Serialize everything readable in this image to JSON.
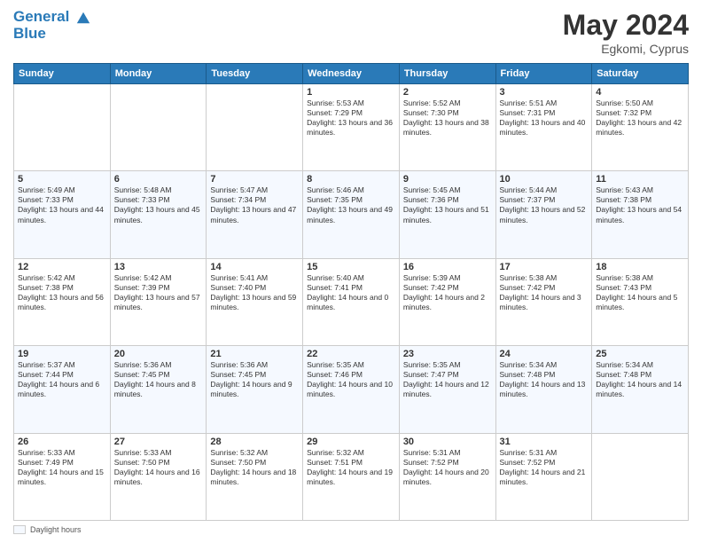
{
  "header": {
    "logo_line1": "General",
    "logo_line2": "Blue",
    "month": "May 2024",
    "location": "Egkomi, Cyprus"
  },
  "weekdays": [
    "Sunday",
    "Monday",
    "Tuesday",
    "Wednesday",
    "Thursday",
    "Friday",
    "Saturday"
  ],
  "footer": {
    "daylight_label": "Daylight hours"
  },
  "weeks": [
    [
      {
        "day": "",
        "sunrise": "",
        "sunset": "",
        "daylight": ""
      },
      {
        "day": "",
        "sunrise": "",
        "sunset": "",
        "daylight": ""
      },
      {
        "day": "",
        "sunrise": "",
        "sunset": "",
        "daylight": ""
      },
      {
        "day": "1",
        "sunrise": "Sunrise: 5:53 AM",
        "sunset": "Sunset: 7:29 PM",
        "daylight": "Daylight: 13 hours and 36 minutes."
      },
      {
        "day": "2",
        "sunrise": "Sunrise: 5:52 AM",
        "sunset": "Sunset: 7:30 PM",
        "daylight": "Daylight: 13 hours and 38 minutes."
      },
      {
        "day": "3",
        "sunrise": "Sunrise: 5:51 AM",
        "sunset": "Sunset: 7:31 PM",
        "daylight": "Daylight: 13 hours and 40 minutes."
      },
      {
        "day": "4",
        "sunrise": "Sunrise: 5:50 AM",
        "sunset": "Sunset: 7:32 PM",
        "daylight": "Daylight: 13 hours and 42 minutes."
      }
    ],
    [
      {
        "day": "5",
        "sunrise": "Sunrise: 5:49 AM",
        "sunset": "Sunset: 7:33 PM",
        "daylight": "Daylight: 13 hours and 44 minutes."
      },
      {
        "day": "6",
        "sunrise": "Sunrise: 5:48 AM",
        "sunset": "Sunset: 7:33 PM",
        "daylight": "Daylight: 13 hours and 45 minutes."
      },
      {
        "day": "7",
        "sunrise": "Sunrise: 5:47 AM",
        "sunset": "Sunset: 7:34 PM",
        "daylight": "Daylight: 13 hours and 47 minutes."
      },
      {
        "day": "8",
        "sunrise": "Sunrise: 5:46 AM",
        "sunset": "Sunset: 7:35 PM",
        "daylight": "Daylight: 13 hours and 49 minutes."
      },
      {
        "day": "9",
        "sunrise": "Sunrise: 5:45 AM",
        "sunset": "Sunset: 7:36 PM",
        "daylight": "Daylight: 13 hours and 51 minutes."
      },
      {
        "day": "10",
        "sunrise": "Sunrise: 5:44 AM",
        "sunset": "Sunset: 7:37 PM",
        "daylight": "Daylight: 13 hours and 52 minutes."
      },
      {
        "day": "11",
        "sunrise": "Sunrise: 5:43 AM",
        "sunset": "Sunset: 7:38 PM",
        "daylight": "Daylight: 13 hours and 54 minutes."
      }
    ],
    [
      {
        "day": "12",
        "sunrise": "Sunrise: 5:42 AM",
        "sunset": "Sunset: 7:38 PM",
        "daylight": "Daylight: 13 hours and 56 minutes."
      },
      {
        "day": "13",
        "sunrise": "Sunrise: 5:42 AM",
        "sunset": "Sunset: 7:39 PM",
        "daylight": "Daylight: 13 hours and 57 minutes."
      },
      {
        "day": "14",
        "sunrise": "Sunrise: 5:41 AM",
        "sunset": "Sunset: 7:40 PM",
        "daylight": "Daylight: 13 hours and 59 minutes."
      },
      {
        "day": "15",
        "sunrise": "Sunrise: 5:40 AM",
        "sunset": "Sunset: 7:41 PM",
        "daylight": "Daylight: 14 hours and 0 minutes."
      },
      {
        "day": "16",
        "sunrise": "Sunrise: 5:39 AM",
        "sunset": "Sunset: 7:42 PM",
        "daylight": "Daylight: 14 hours and 2 minutes."
      },
      {
        "day": "17",
        "sunrise": "Sunrise: 5:38 AM",
        "sunset": "Sunset: 7:42 PM",
        "daylight": "Daylight: 14 hours and 3 minutes."
      },
      {
        "day": "18",
        "sunrise": "Sunrise: 5:38 AM",
        "sunset": "Sunset: 7:43 PM",
        "daylight": "Daylight: 14 hours and 5 minutes."
      }
    ],
    [
      {
        "day": "19",
        "sunrise": "Sunrise: 5:37 AM",
        "sunset": "Sunset: 7:44 PM",
        "daylight": "Daylight: 14 hours and 6 minutes."
      },
      {
        "day": "20",
        "sunrise": "Sunrise: 5:36 AM",
        "sunset": "Sunset: 7:45 PM",
        "daylight": "Daylight: 14 hours and 8 minutes."
      },
      {
        "day": "21",
        "sunrise": "Sunrise: 5:36 AM",
        "sunset": "Sunset: 7:45 PM",
        "daylight": "Daylight: 14 hours and 9 minutes."
      },
      {
        "day": "22",
        "sunrise": "Sunrise: 5:35 AM",
        "sunset": "Sunset: 7:46 PM",
        "daylight": "Daylight: 14 hours and 10 minutes."
      },
      {
        "day": "23",
        "sunrise": "Sunrise: 5:35 AM",
        "sunset": "Sunset: 7:47 PM",
        "daylight": "Daylight: 14 hours and 12 minutes."
      },
      {
        "day": "24",
        "sunrise": "Sunrise: 5:34 AM",
        "sunset": "Sunset: 7:48 PM",
        "daylight": "Daylight: 14 hours and 13 minutes."
      },
      {
        "day": "25",
        "sunrise": "Sunrise: 5:34 AM",
        "sunset": "Sunset: 7:48 PM",
        "daylight": "Daylight: 14 hours and 14 minutes."
      }
    ],
    [
      {
        "day": "26",
        "sunrise": "Sunrise: 5:33 AM",
        "sunset": "Sunset: 7:49 PM",
        "daylight": "Daylight: 14 hours and 15 minutes."
      },
      {
        "day": "27",
        "sunrise": "Sunrise: 5:33 AM",
        "sunset": "Sunset: 7:50 PM",
        "daylight": "Daylight: 14 hours and 16 minutes."
      },
      {
        "day": "28",
        "sunrise": "Sunrise: 5:32 AM",
        "sunset": "Sunset: 7:50 PM",
        "daylight": "Daylight: 14 hours and 18 minutes."
      },
      {
        "day": "29",
        "sunrise": "Sunrise: 5:32 AM",
        "sunset": "Sunset: 7:51 PM",
        "daylight": "Daylight: 14 hours and 19 minutes."
      },
      {
        "day": "30",
        "sunrise": "Sunrise: 5:31 AM",
        "sunset": "Sunset: 7:52 PM",
        "daylight": "Daylight: 14 hours and 20 minutes."
      },
      {
        "day": "31",
        "sunrise": "Sunrise: 5:31 AM",
        "sunset": "Sunset: 7:52 PM",
        "daylight": "Daylight: 14 hours and 21 minutes."
      },
      {
        "day": "",
        "sunrise": "",
        "sunset": "",
        "daylight": ""
      }
    ]
  ]
}
